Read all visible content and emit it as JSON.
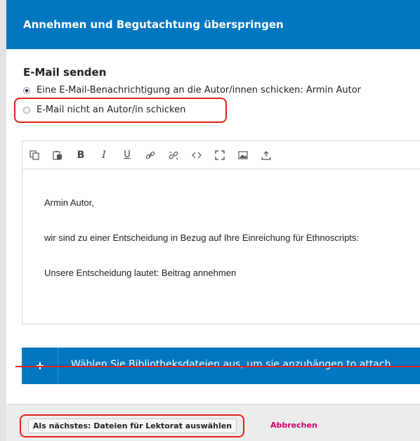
{
  "dialog": {
    "title": "Annehmen und Begutachtung überspringen"
  },
  "email_section": {
    "heading": "E-Mail senden",
    "options": [
      {
        "label": "Eine E-Mail-Benachrichtigung an die Autor/innen schicken: Armin Autor",
        "checked": true
      },
      {
        "label": "E-Mail nicht an Autor/in schicken",
        "checked": false
      }
    ]
  },
  "editor": {
    "toolbar_icons": [
      "copy-icon",
      "paste-icon",
      "bold-icon",
      "italic-icon",
      "underline-icon",
      "link-icon",
      "unlink-icon",
      "code-icon",
      "fullscreen-icon",
      "image-icon",
      "upload-icon"
    ],
    "body_lines": [
      "Armin Autor,",
      "wir sind zu einer Entscheidung in Bezug auf Ihre Einreichung für Ethnoscripts:",
      "Unsere Entscheidung lautet: Beitrag annehmen"
    ]
  },
  "attach_bar": {
    "label": "Wählen Sie Bibliotheksdateien aus, um sie anzuhängen.to attach",
    "accent": "#0077c0"
  },
  "footer": {
    "next_label": "Als nächstes: Dateien für Lektorat auswählen",
    "cancel_label": "Abbrechen"
  },
  "colors": {
    "header": "#0077c0",
    "highlight": "#e2231a",
    "cancel": "#d1006a"
  }
}
